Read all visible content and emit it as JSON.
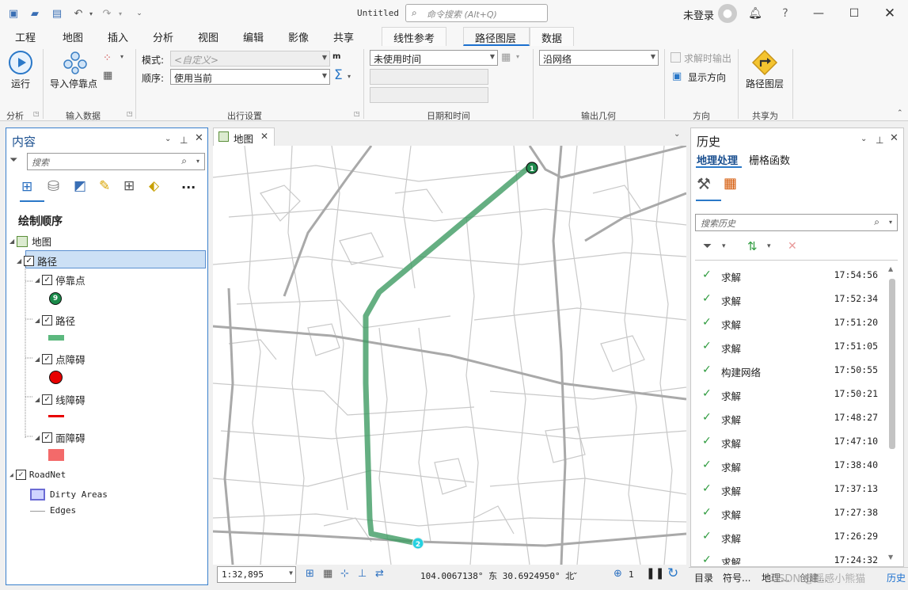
{
  "window": {
    "title": "Untitled",
    "command_search_placeholder": "命令搜索 (Alt+Q)",
    "user": "未登录",
    "help": "?"
  },
  "ribbon_tabs": [
    "工程",
    "地图",
    "插入",
    "分析",
    "视图",
    "编辑",
    "影像",
    "共享",
    "线性参考",
    "路径图层",
    "数据"
  ],
  "ribbon": {
    "run_label": "运行",
    "import_stops_label": "导入停靠点",
    "mode_label": "模式:",
    "mode_value": "<自定义>",
    "order_label": "顺序:",
    "order_value": "使用当前",
    "time_value": "未使用时间",
    "output_geometry_value": "沿网络",
    "output_on_solve_label": "求解时输出",
    "show_direction_label": "显示方向",
    "route_layer_label": "路径图层",
    "groups": [
      "分析",
      "输入数据",
      "出行设置",
      "日期和时间",
      "输出几何",
      "方向",
      "共享为"
    ]
  },
  "contents": {
    "title": "内容",
    "search_placeholder": "搜索",
    "drawing_order": "绘制顺序",
    "map_name": "地图",
    "route_layer": "路径",
    "sublayers": [
      "停靠点",
      "路径",
      "点障碍",
      "线障碍",
      "面障碍"
    ],
    "stop_symbol_number": "9",
    "roadnet": "RoadNet",
    "dirty_areas": "Dirty Areas",
    "edges": "Edges"
  },
  "map_tab": "地图",
  "map": {
    "stop_labels": [
      "1",
      "2"
    ],
    "scale": "1:32,895",
    "coords": "104.0067138° 东  30.6924950° 北",
    "selected_count": "1",
    "route_color": "#3f9b63",
    "stop_start_color": "#1f8a4c",
    "stop_end_color": "#25d1e0"
  },
  "history": {
    "title": "历史",
    "tabs": [
      "地理处理",
      "栅格函数"
    ],
    "search_placeholder": "搜索历史",
    "rows": [
      {
        "name": "求解",
        "time": "17:54:56"
      },
      {
        "name": "求解",
        "time": "17:52:34"
      },
      {
        "name": "求解",
        "time": "17:51:20"
      },
      {
        "name": "求解",
        "time": "17:51:05"
      },
      {
        "name": "构建网络",
        "time": "17:50:55"
      },
      {
        "name": "求解",
        "time": "17:50:21"
      },
      {
        "name": "求解",
        "time": "17:48:27"
      },
      {
        "name": "求解",
        "time": "17:47:10"
      },
      {
        "name": "求解",
        "time": "17:38:40"
      },
      {
        "name": "求解",
        "time": "17:37:13"
      },
      {
        "name": "求解",
        "time": "17:27:38"
      },
      {
        "name": "求解",
        "time": "17:26:29"
      },
      {
        "name": "求解",
        "time": "17:24:32"
      }
    ]
  },
  "bottom_tabs": [
    "目录",
    "符号...",
    "地理...",
    "创建...",
    "历史"
  ],
  "watermark": "CSDN @遥感小熊猫"
}
